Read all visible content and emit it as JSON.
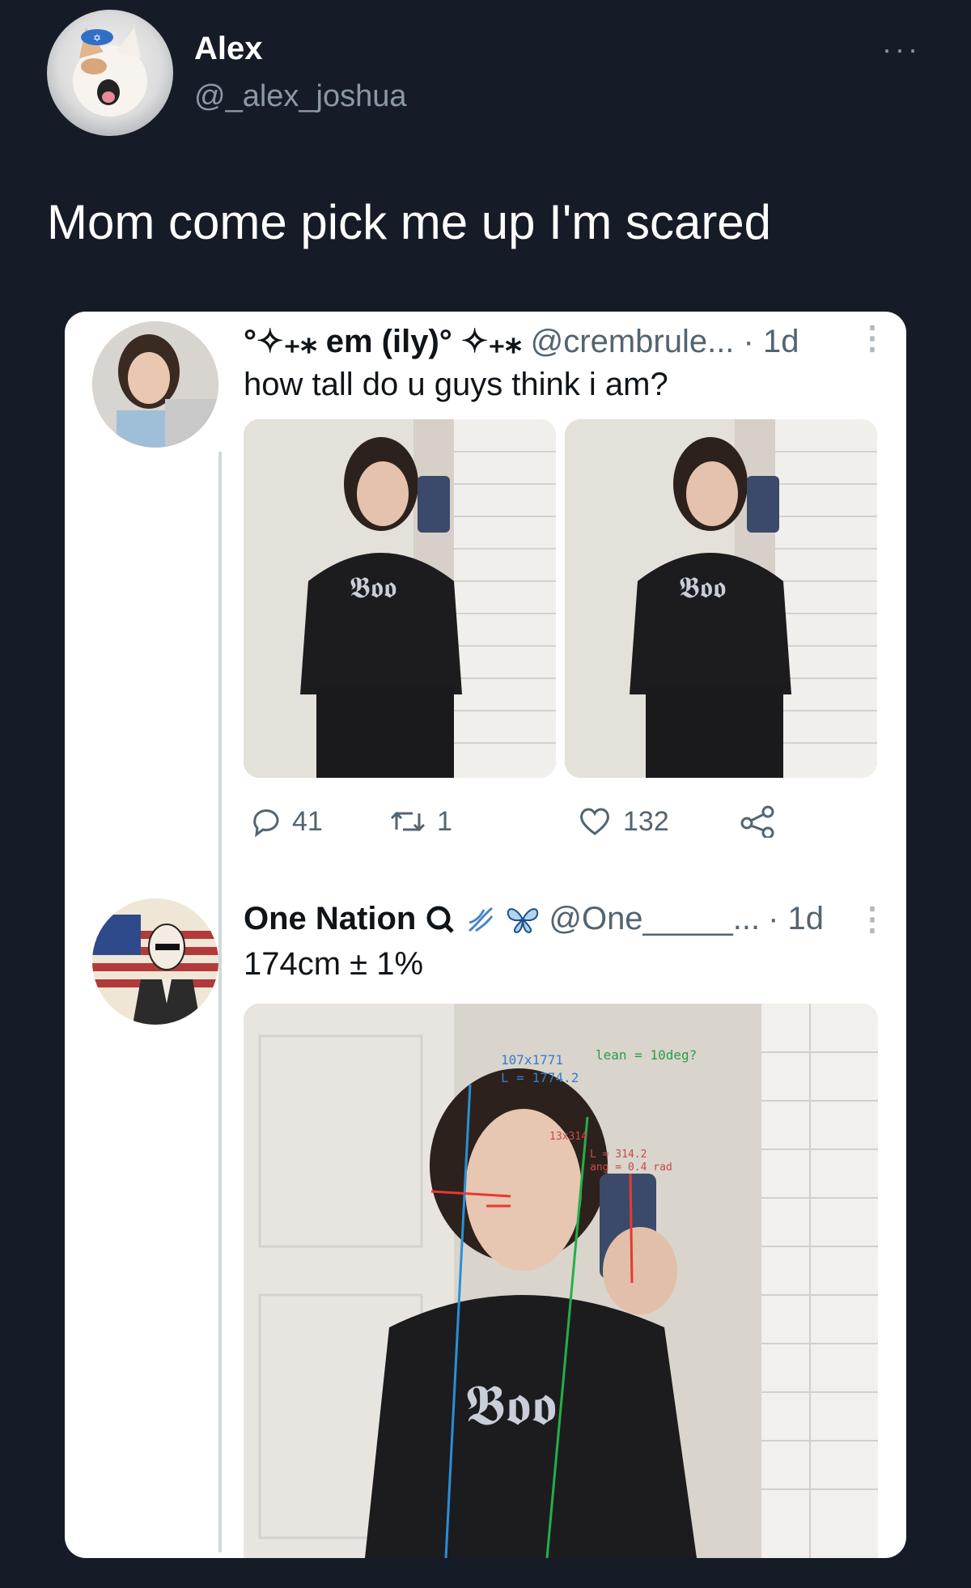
{
  "outer_tweet": {
    "author_name": "Alex",
    "author_handle": "@_alex_joshua",
    "more_label": "···",
    "text": "Mom come pick me up I'm scared"
  },
  "quoted_thread": {
    "post1": {
      "author_name": "°✧₊⁎ em (ily)° ✧₊⁎",
      "author_handle": "@crembrule...",
      "time": "· 1d",
      "text": "how tall do u guys think i am?",
      "actions": {
        "replies": "41",
        "retweets": "1",
        "likes": "132"
      }
    },
    "post2": {
      "author_name": "One Nation",
      "author_handle": "@One_____...",
      "time": "· 1d",
      "text": "174cm ± 1%",
      "annotations": {
        "size": "107x1771",
        "length": "L = 1774.2",
        "lean": "lean = 10deg?",
        "phone_size": "13x314",
        "phone_length": "L = 314.2",
        "angle": "ang = 0.4 rad"
      }
    },
    "icons": [
      "reply-icon",
      "retweet-icon",
      "like-icon",
      "share-icon",
      "kebab-icon",
      "magnifier-icon",
      "dna-icon",
      "butterfly-icon"
    ]
  }
}
